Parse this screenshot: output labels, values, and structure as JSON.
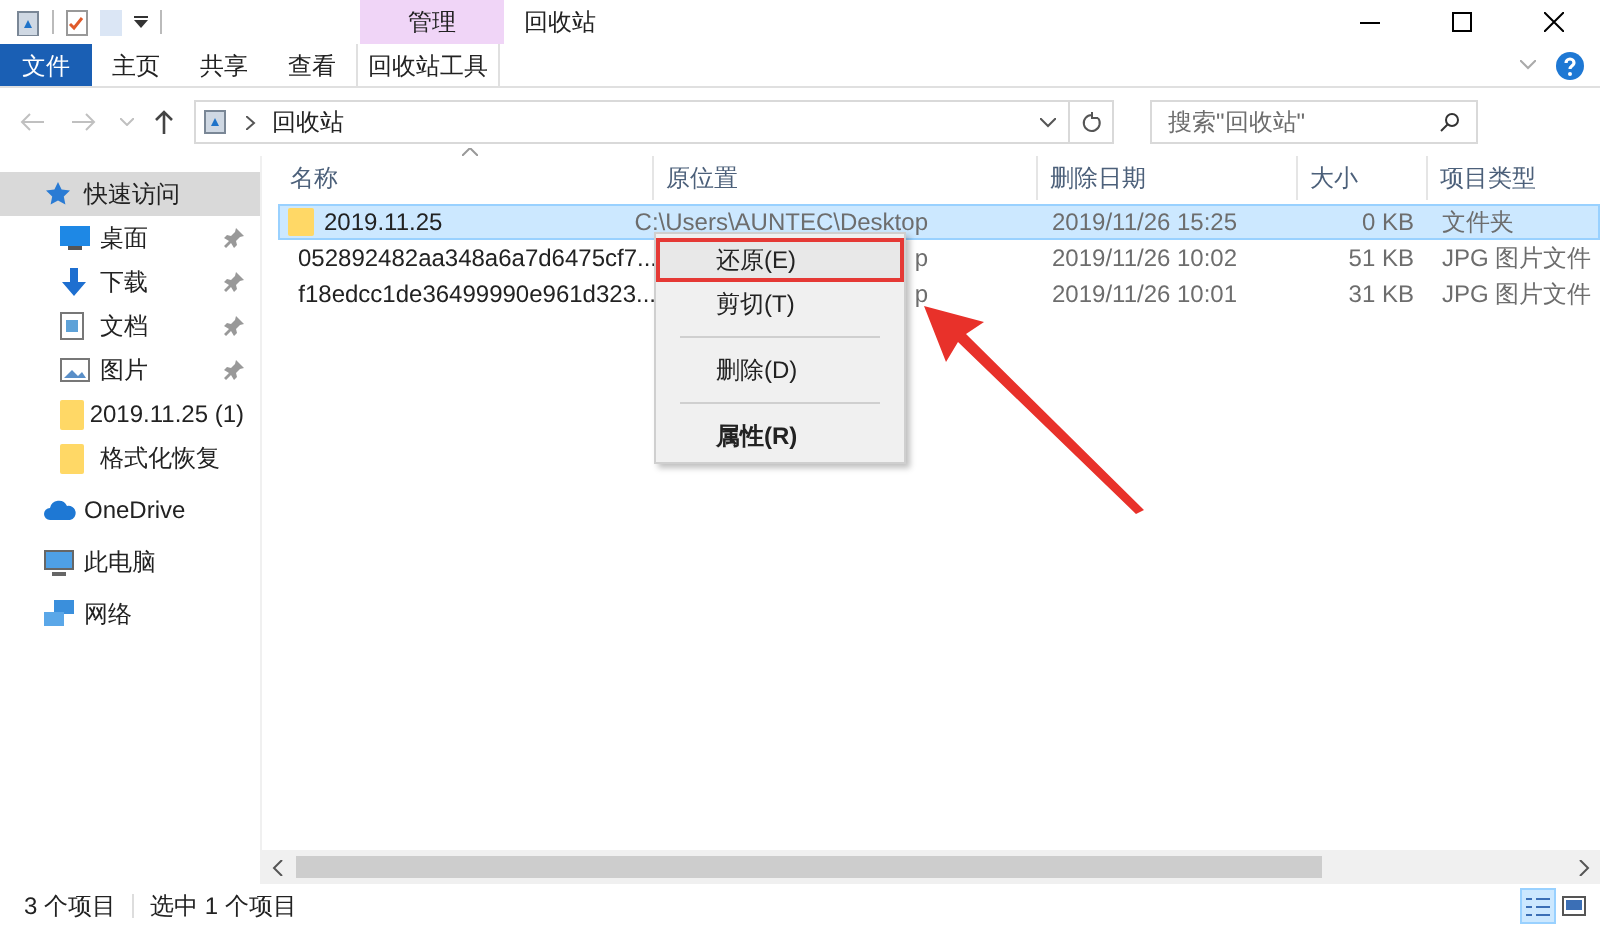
{
  "window": {
    "title": "回收站"
  },
  "ribbon_tabs": [
    {
      "label": "文件",
      "kind": "file"
    },
    {
      "label": "主页",
      "kind": "tab"
    },
    {
      "label": "共享",
      "kind": "tab"
    },
    {
      "label": "查看",
      "kind": "tab"
    },
    {
      "label": "回收站工具",
      "kind": "contextual",
      "group": "管理"
    }
  ],
  "address_bar": {
    "path": "回收站"
  },
  "search": {
    "placeholder": "搜索\"回收站\""
  },
  "sidebar": {
    "items": [
      {
        "label": "快速访问",
        "kind": "star",
        "selected": true,
        "children": [
          {
            "label": "桌面",
            "kind": "desktop",
            "pinned": true,
            "selected": false
          },
          {
            "label": "下载",
            "kind": "download",
            "pinned": true,
            "selected": false
          },
          {
            "label": "文档",
            "kind": "document",
            "pinned": true,
            "selected": false
          },
          {
            "label": "图片",
            "kind": "picture",
            "pinned": true,
            "selected": false
          },
          {
            "label": "2019.11.25 (1)",
            "kind": "folder",
            "pinned": false,
            "selected": false
          },
          {
            "label": "格式化恢复",
            "kind": "folder",
            "pinned": false,
            "selected": false
          }
        ]
      },
      {
        "label": "OneDrive",
        "kind": "cloud",
        "selected": false
      },
      {
        "label": "此电脑",
        "kind": "computer",
        "selected": false
      },
      {
        "label": "网络",
        "kind": "network",
        "selected": false
      }
    ]
  },
  "table": {
    "columns": [
      "名称",
      "原位置",
      "删除日期",
      "大小",
      "项目类型"
    ],
    "rows": [
      {
        "kind": "folder",
        "name": "2019.11.25",
        "location": "C:\\Users\\AUNTEC\\Desktop",
        "deleted": "2019/11/26 15:25",
        "size": "0 KB",
        "type": "文件夹",
        "selected": true
      },
      {
        "kind": "jpg",
        "name": "052892482aa348a6a7d6475cf7...",
        "location": "p",
        "deleted": "2019/11/26 10:02",
        "size": "51 KB",
        "type": "JPG 图片文件",
        "selected": false
      },
      {
        "kind": "jpg",
        "name": "f18edcc1de36499990e961d323...",
        "location": "p",
        "deleted": "2019/11/26 10:01",
        "size": "31 KB",
        "type": "JPG 图片文件",
        "selected": false
      }
    ]
  },
  "context_menu": {
    "items": [
      {
        "kind": "item",
        "label": "还原(E)",
        "bold": false,
        "selected": true
      },
      {
        "kind": "item",
        "label": "剪切(T)",
        "bold": false,
        "selected": false
      },
      {
        "kind": "separator"
      },
      {
        "kind": "item",
        "label": "删除(D)",
        "bold": false,
        "selected": false
      },
      {
        "kind": "separator"
      },
      {
        "kind": "item",
        "label": "属性(R)",
        "bold": true,
        "selected": false
      }
    ]
  },
  "status_bar": {
    "count": "3 个项目",
    "selection": "选中 1 个项目",
    "views": [
      {
        "kind": "details",
        "selected": true
      },
      {
        "kind": "large",
        "selected": false
      }
    ]
  }
}
